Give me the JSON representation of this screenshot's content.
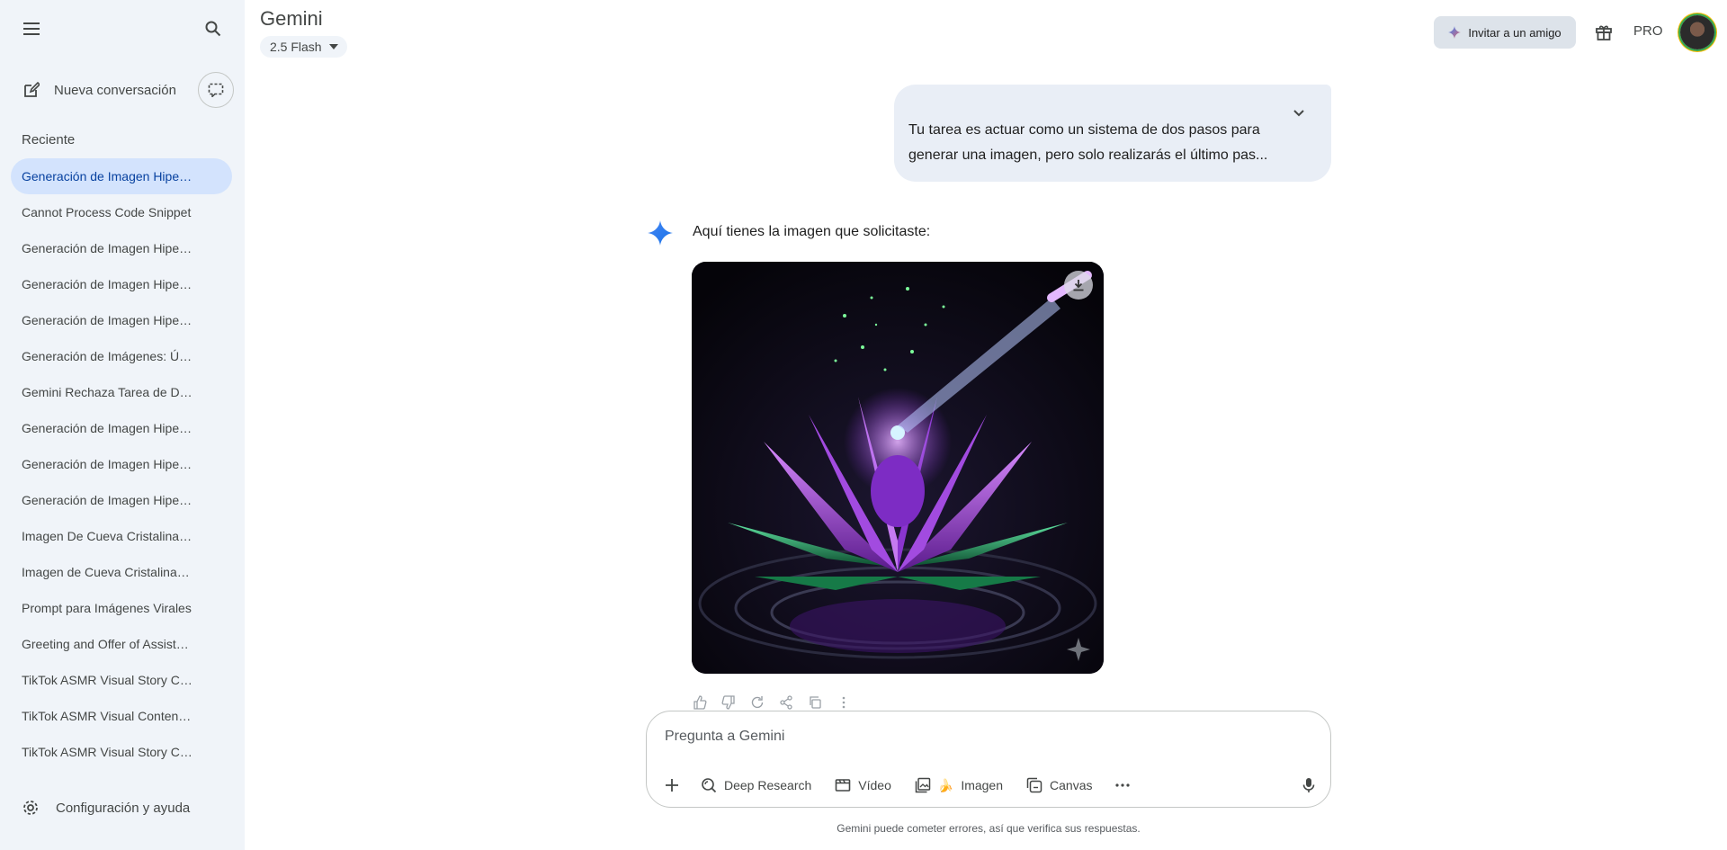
{
  "app": {
    "title": "Gemini",
    "model": "2.5 Flash"
  },
  "sidebar": {
    "new_chat": "Nueva conversación",
    "recent_label": "Reciente",
    "items": [
      "Generación de Imagen Hiperrealista",
      "Cannot Process Code Snippet",
      "Generación de Imagen Hiperrealista",
      "Generación de Imagen Hiperrealista",
      "Generación de Imagen Hiperrealista",
      "Generación de Imágenes: Último Paso",
      "Gemini Rechaza Tarea de Dos Pasos",
      "Generación de Imagen Hiperrealista",
      "Generación de Imagen Hiperrealista",
      "Generación de Imagen Hiperrealista",
      "Imagen De Cueva Cristalina Brillante",
      "Imagen de Cueva Cristalina Brillante",
      "Prompt para Imágenes Virales",
      "Greeting and Offer of Assistance",
      "TikTok ASMR Visual Story Concepts",
      "TikTok ASMR Visual Content Ideas",
      "TikTok ASMR Visual Story Concepts"
    ],
    "settings": "Configuración y ayuda"
  },
  "header": {
    "invite": "Invitar a un amigo",
    "pro": "PRO"
  },
  "conversation": {
    "user_message_line1": "Tu tarea es actuar como un sistema de dos pasos para",
    "user_message_line2": "generar una imagen, pero solo realizarás el último pas...",
    "model_reply": "Aquí tienes la imagen que solicitaste:"
  },
  "composer": {
    "placeholder": "Pregunta a Gemini",
    "tools": {
      "deep_research": "Deep Research",
      "video": "Vídeo",
      "image": "Imagen",
      "image_emoji": "🍌",
      "canvas": "Canvas"
    }
  },
  "footer": {
    "disclaimer": "Gemini puede cometer errores, así que verifica sus respuestas."
  },
  "colors": {
    "sidebar_bg": "#f0f4f9",
    "active_item": "#d3e3fd",
    "accent_blue": "#4285f4",
    "lotus_purple": "#a24be0",
    "lotus_green": "#1f8f55"
  }
}
